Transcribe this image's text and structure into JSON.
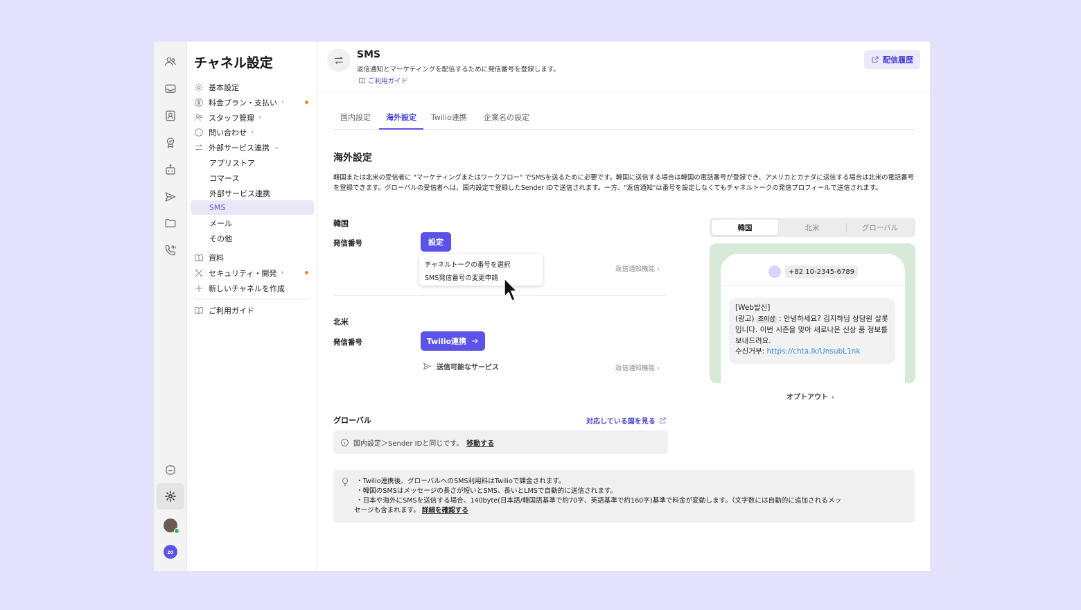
{
  "sidebar": {
    "title": "チャネル設定",
    "items": [
      {
        "label": "基本設定"
      },
      {
        "label": "料金プラン・支払い"
      },
      {
        "label": "スタッフ管理"
      },
      {
        "label": "問い合わせ"
      },
      {
        "label": "外部サービス連携"
      },
      {
        "label": "アプリストア"
      },
      {
        "label": "コマース"
      },
      {
        "label": "外部サービス連携"
      },
      {
        "label": "SMS"
      },
      {
        "label": "メール"
      },
      {
        "label": "その他"
      },
      {
        "label": "資料"
      },
      {
        "label": "セキュリティ・開発"
      },
      {
        "label": "新しいチャネルを作成"
      },
      {
        "label": "ご利用ガイド"
      }
    ],
    "chevron": "›",
    "chevron_down": "⌄",
    "selected": "SMS"
  },
  "header": {
    "title": "SMS",
    "description": "返信通知とマーケティングを配信するために発信番号を登録します。",
    "guide_link": "ご利用ガイド",
    "history_button": "配信履歴"
  },
  "tabs": [
    {
      "label": "国内設定"
    },
    {
      "label": "海外設定"
    },
    {
      "label": "Twilio連携"
    },
    {
      "label": "企業名の設定"
    }
  ],
  "active_tab": "海外設定",
  "section": {
    "title": "海外設定",
    "description": "韓国または北米の受信者に \"マーケティングまたはワークフロー\" でSMSを送るために必要です。韓国に送信する場合は韓国の電話番号が登録でき、アメリカとカナダに送信する場合は北米の電話番号を登録できます。グローバルの受信者へは、国内設定で登録したSender IDで送信されます。一方、\"返信通知\"は番号を設定しなくてもチャネルトークの発信プロフィールで送信されます。"
  },
  "korea": {
    "heading": "韓国",
    "number_label": "発信番号",
    "setup_button": "設定",
    "menu": [
      "チャネルトークの番号を選択",
      "SMS発信番号の変更申請"
    ],
    "reply_link": "返信通知機能 ›"
  },
  "north_america": {
    "heading": "北米",
    "number_label": "発信番号",
    "twilio_button": "Twilio連携",
    "service_link": "送信可能なサービス",
    "reply_link": "返信通知機能 ›"
  },
  "global": {
    "heading": "グローバル",
    "countries_link": "対応している国を見る",
    "info_text": "国内設定＞Sender IDと同じです。",
    "move_link": "移動する"
  },
  "preview": {
    "segments": [
      "韓国",
      "北米",
      "グローバル"
    ],
    "active_segment": "韓国",
    "phone_number": "+82 10-2345-6789",
    "message_line1": "[Web발신]",
    "message_prefix": "(광고)",
    "message_tag": "조이샵",
    "message_body": ": 안녕하세요? 김지하님 상담원 살롯입니다. 이번 시즌을 맞아 새로나온 신상 품 정보를 보내드려요.",
    "unsub_label": "수신거부:",
    "unsub_url": "https://chta.lk/UnsubL1nk",
    "optout_label": "オプトアウト",
    "optout_caret": "▾"
  },
  "notes": {
    "line1": "・Twilio連携後、グローバルへのSMS利用料はTwilioで課金されます。",
    "line2": "・韓国のSMSはメッセージの長さが短いとSMS、長いとLMSで自動的に送信されます。",
    "line3": "・日本や海外にSMSを送信する場合、140byte(日本語/韓国語基準で約70字、英語基準で約160字)基準で料金が変動します。（文字数には自動的に追加されるメッ",
    "line4": "セージも含まれます。",
    "details_link": "詳細を確認する"
  },
  "brand": {
    "zo_badge": "zo",
    "accent": "#5b52e8",
    "orange_dot": "#f08a24"
  }
}
